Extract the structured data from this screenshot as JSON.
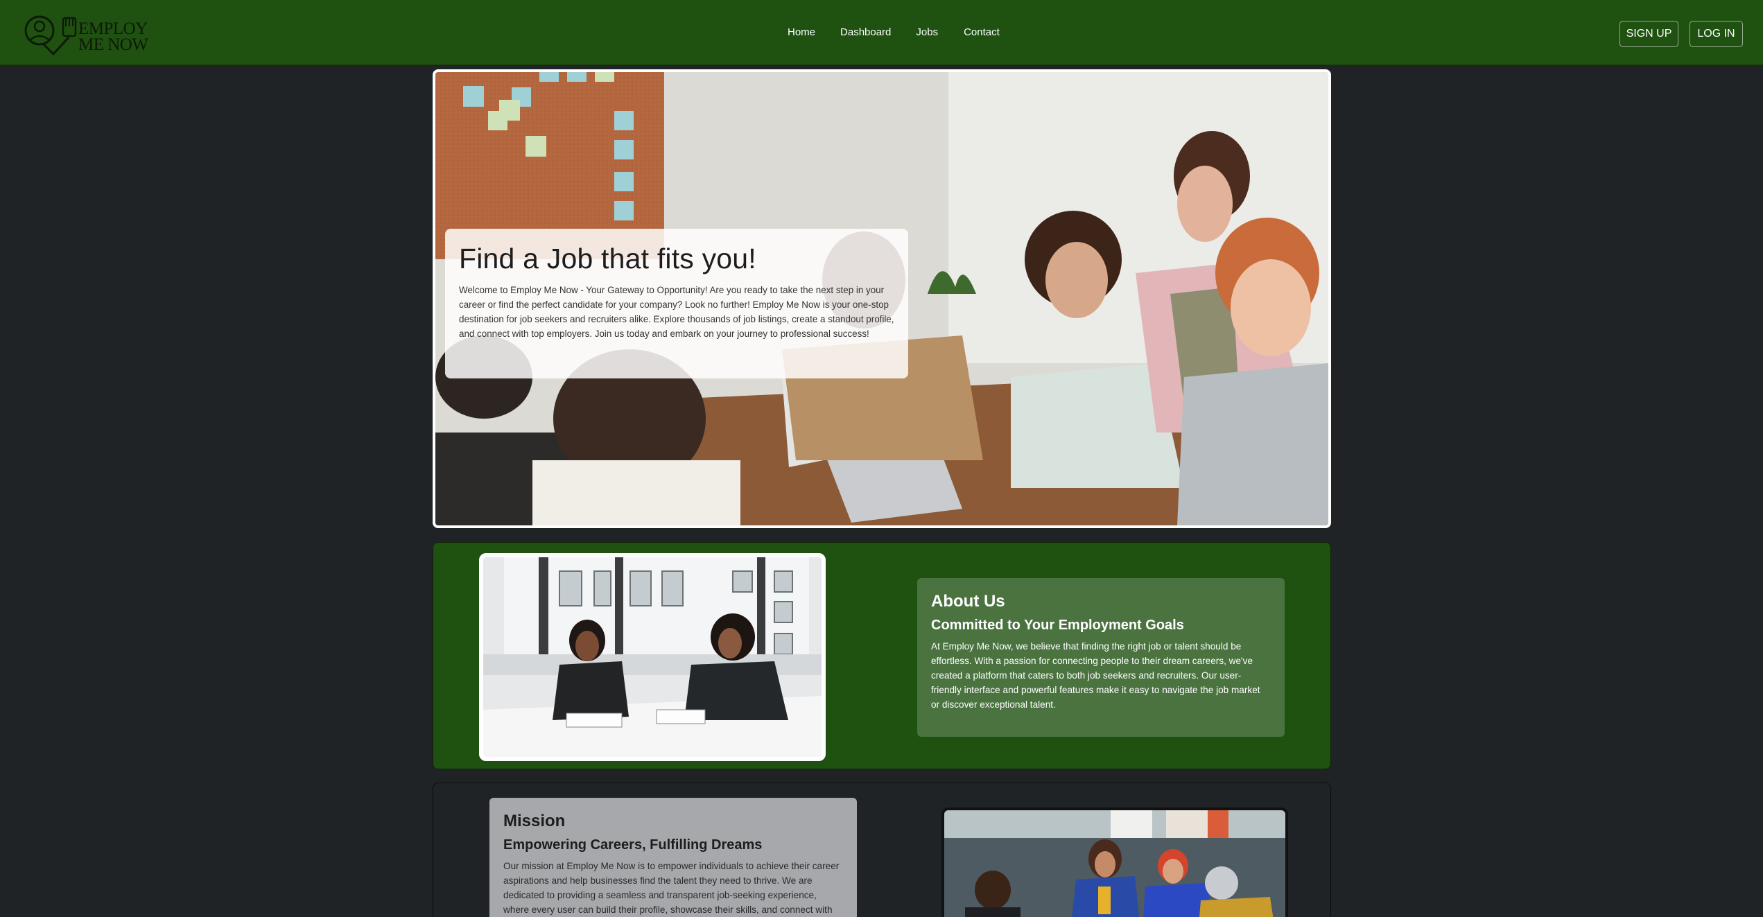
{
  "brand": {
    "logo_line1": "EMPLOY",
    "logo_line2": "ME NOW",
    "nav_color": "#1f5110"
  },
  "nav": {
    "links": [
      "Home",
      "Dashboard",
      "Jobs",
      "Contact"
    ]
  },
  "auth": {
    "signup_label": "SIGN UP",
    "login_label": "LOG IN"
  },
  "hero": {
    "title": "Find a Job that fits you!",
    "text": "Welcome to Employ Me Now - Your Gateway to Opportunity! Are you ready to take the next step in your career or find the perfect candidate for your company? Look no further! Employ Me Now is your one-stop destination for job seekers and recruiters alike. Explore thousands of job listings, create a standout profile, and connect with top employers. Join us today and embark on your journey to professional success!"
  },
  "about": {
    "heading": "About Us",
    "subheading": "Committed to Your Employment Goals",
    "text": "At Employ Me Now, we believe that finding the right job or talent should be effortless. With a passion for connecting people to their dream careers, we've created a platform that caters to both job seekers and recruiters. Our user-friendly interface and powerful features make it easy to navigate the job market or discover exceptional talent."
  },
  "mission": {
    "heading": "Mission",
    "subheading": "Empowering Careers, Fulfilling Dreams",
    "text": "Our mission at Employ Me Now is to empower individuals to achieve their career aspirations and help businesses find the talent they need to thrive. We are dedicated to providing a seamless and transparent job-seeking experience, where every user can build their profile, showcase their skills, and connect with"
  }
}
